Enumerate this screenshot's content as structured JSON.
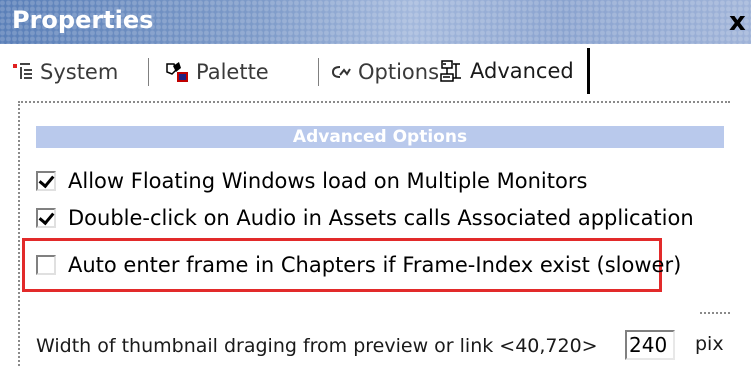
{
  "window": {
    "title": "Properties",
    "close_glyph": "x"
  },
  "tabs": [
    {
      "label": "System",
      "icon": "system-icon",
      "active": false
    },
    {
      "label": "Palette",
      "icon": "palette-icon",
      "active": false
    },
    {
      "label": "Options",
      "icon": "options-icon",
      "active": false
    },
    {
      "label": "Advanced",
      "icon": "advanced-icon",
      "active": true
    }
  ],
  "section": {
    "header": "Advanced Options"
  },
  "options": [
    {
      "label": "Allow Floating Windows load on Multiple Monitors",
      "checked": true
    },
    {
      "label": "Double-click on Audio in Assets calls Associated application",
      "checked": true
    },
    {
      "label": "Auto enter frame in Chapters if Frame-Index exist (slower)",
      "checked": false,
      "highlighted": true
    }
  ],
  "thumbnail": {
    "label": "Width of thumbnail draging from preview or link  <40,720>",
    "value": "240",
    "unit": "pix"
  },
  "colors": {
    "titlebar": "#7b97c4",
    "section_header_bg": "#b9c9ec",
    "highlight_border": "#e22a2a"
  }
}
